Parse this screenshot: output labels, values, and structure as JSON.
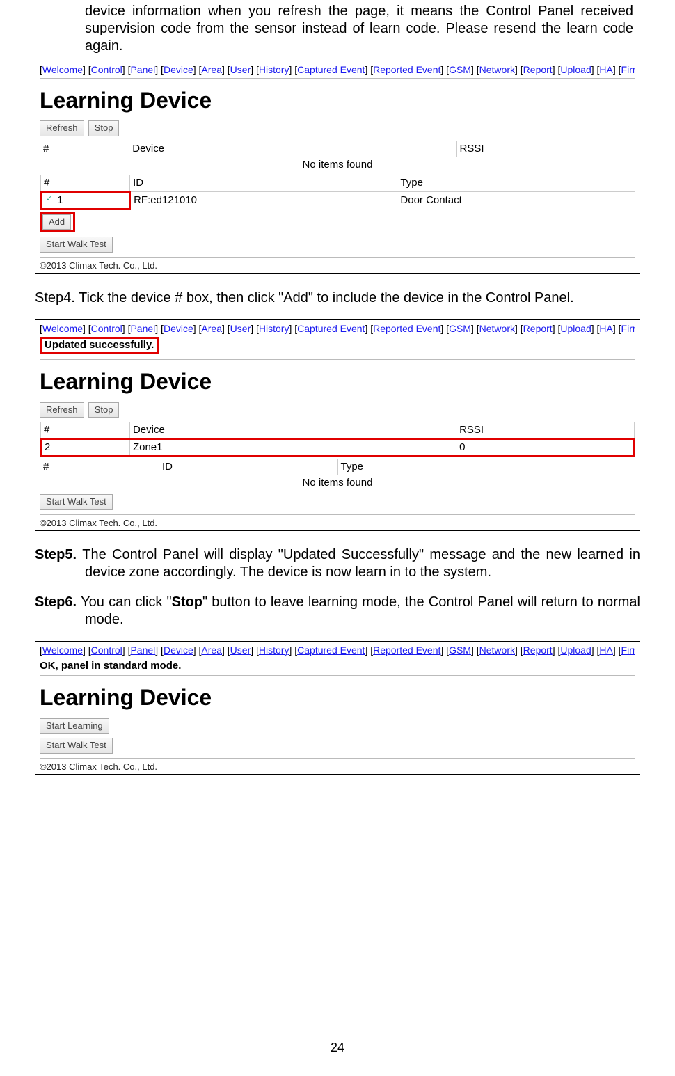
{
  "intro": "device information when you refresh the page, it means the Control Panel received supervision code from the sensor instead of learn code. Please resend the learn code again.",
  "nav": {
    "items": [
      "Welcome",
      "Control",
      "Panel",
      "Device",
      "Area",
      "User",
      "History",
      "Captured Event",
      "Reported Event",
      "GSM",
      "Network",
      "Report",
      "Upload",
      "HA",
      "Firmware"
    ]
  },
  "shot1": {
    "title": "Learning Device",
    "refresh": "Refresh",
    "stop": "Stop",
    "h_num": "#",
    "h_dev": "Device",
    "h_rssi": "RSSI",
    "noitems": "No items found",
    "h_id": "ID",
    "h_type": "Type",
    "row_num": "1",
    "row_id": "RF:ed121010",
    "row_type": "Door Contact",
    "add": "Add",
    "walk": "Start Walk Test",
    "copy": "©2013 Climax Tech. Co., Ltd."
  },
  "step4": "Step4. Tick the device # box, then click \"Add\" to include the device in the Control Panel.",
  "shot2": {
    "title": "Learning Device",
    "msg": "Updated successfully.",
    "refresh": "Refresh",
    "stop": "Stop",
    "h_num": "#",
    "h_dev": "Device",
    "h_rssi": "RSSI",
    "row_num": "2",
    "row_dev": "Zone1",
    "row_rssi": "0",
    "h_id": "ID",
    "h_type": "Type",
    "noitems": "No items found",
    "walk": "Start Walk Test",
    "copy": "©2013 Climax Tech. Co., Ltd."
  },
  "step5_a": "Step5. ",
  "step5_b": "The Control Panel will display \"Updated Successfully\" message and the new learned in device zone accordingly. The device is now learn in to the system.",
  "step6_a": "Step6. ",
  "step6_b1": "You can click \"",
  "step6_stop": "Stop",
  "step6_b2": "\" button to leave learning mode, the Control Panel will return to normal mode.",
  "shot3": {
    "title": "Learning Device",
    "status": "OK, panel in standard mode.",
    "start": "Start Learning",
    "walk": "Start Walk Test",
    "copy": "©2013 Climax Tech. Co., Ltd."
  },
  "pagenum": "24"
}
